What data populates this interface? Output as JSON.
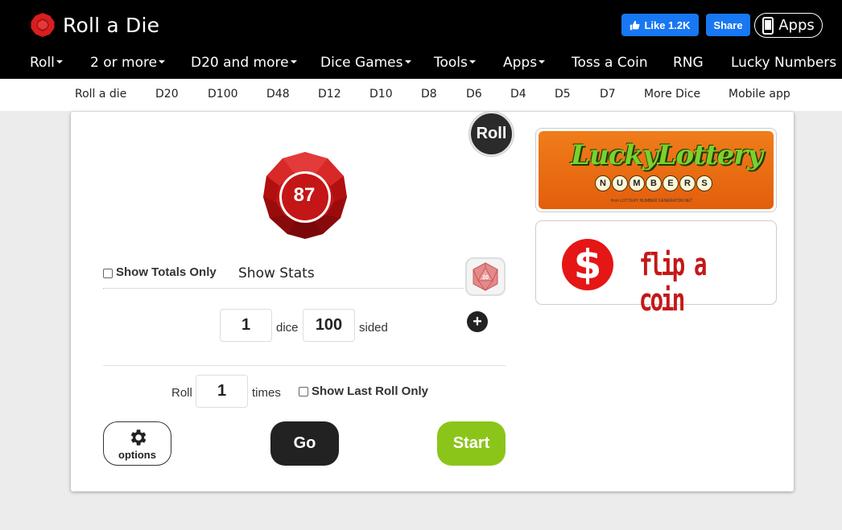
{
  "header": {
    "title": "Roll a Die",
    "fb_like": "Like 1.2K",
    "fb_share": "Share",
    "apps": "Apps"
  },
  "nav": {
    "items": [
      "Roll",
      "2 or more",
      "D20 and more",
      "Dice Games",
      "Tools",
      "Apps",
      "Toss a Coin",
      "RNG",
      "Lucky Numbers"
    ]
  },
  "subnav": {
    "items": [
      "Roll a die",
      "D20",
      "D100",
      "D48",
      "D12",
      "D10",
      "D8",
      "D6",
      "D4",
      "D5",
      "D7",
      "More Dice",
      "Mobile app"
    ]
  },
  "roller": {
    "roll_button": "Roll",
    "die_value": "87",
    "show_totals_only": "Show Totals Only",
    "show_stats": "Show Stats",
    "d20_label": "20",
    "dice_count": "1",
    "dice_label": "dice",
    "sides": "100",
    "sided_label": "sided",
    "plus": "+",
    "roll_label": "Roll",
    "times_value": "1",
    "times_label": "times",
    "show_last_roll_only": "Show Last Roll Only",
    "options_label": "options",
    "go_label": "Go",
    "start_label": "Start"
  },
  "ads": {
    "lottery_title": "LuckyLottery",
    "lottery_letters": [
      "N",
      "U",
      "M",
      "B",
      "E",
      "R",
      "S"
    ],
    "lottery_small": "from LOTTERY NUMBER GENERATOR.NET",
    "coin_symbol": "$",
    "coin_text": "flip a coin"
  },
  "colors": {
    "accent_red": "#d81e1e",
    "start_green": "#8cc51a",
    "fb_blue": "#1877f2"
  }
}
